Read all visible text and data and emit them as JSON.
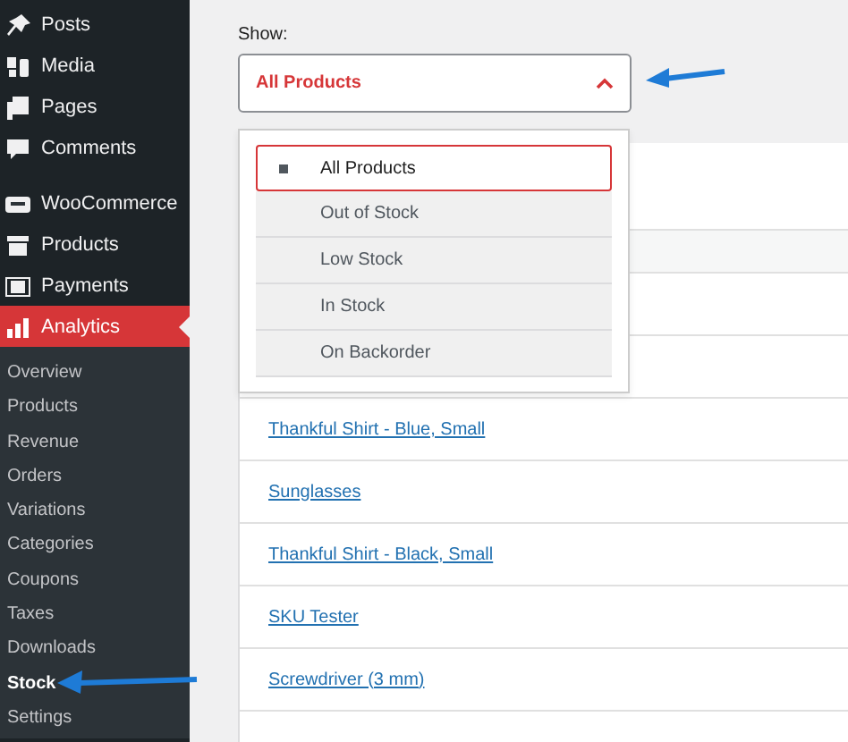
{
  "sidebar": {
    "groups": [
      [
        {
          "label": "Posts",
          "selected": false
        },
        {
          "label": "Media",
          "selected": false
        },
        {
          "label": "Pages",
          "selected": false
        },
        {
          "label": "Comments",
          "selected": false
        }
      ],
      [
        {
          "label": "WooCommerce",
          "selected": false
        },
        {
          "label": "Products",
          "selected": false
        },
        {
          "label": "Payments",
          "selected": false
        },
        {
          "label": "Analytics",
          "selected": true
        }
      ]
    ],
    "submenu": [
      {
        "label": "Overview",
        "selected": false
      },
      {
        "label": "Products",
        "selected": false
      },
      {
        "label": "Revenue",
        "selected": false
      },
      {
        "label": "Orders",
        "selected": false
      },
      {
        "label": "Variations",
        "selected": false
      },
      {
        "label": "Categories",
        "selected": false
      },
      {
        "label": "Coupons",
        "selected": false
      },
      {
        "label": "Taxes",
        "selected": false
      },
      {
        "label": "Downloads",
        "selected": false
      },
      {
        "label": "Stock",
        "selected": true
      },
      {
        "label": "Settings",
        "selected": false
      }
    ]
  },
  "filter": {
    "label": "Show:",
    "value": "All Products",
    "expanded": true,
    "options": [
      {
        "label": "All Products",
        "selected": true
      },
      {
        "label": "Out of Stock",
        "selected": false
      },
      {
        "label": "Low Stock",
        "selected": false
      },
      {
        "label": "In Stock",
        "selected": false
      },
      {
        "label": "On Backorder",
        "selected": false
      }
    ]
  },
  "table": {
    "rows": [
      "Thankful Shirt - Blue, Small",
      "Sunglasses",
      "Thankful Shirt - Black, Small",
      "SKU Tester",
      "Screwdriver (3 mm)"
    ]
  }
}
